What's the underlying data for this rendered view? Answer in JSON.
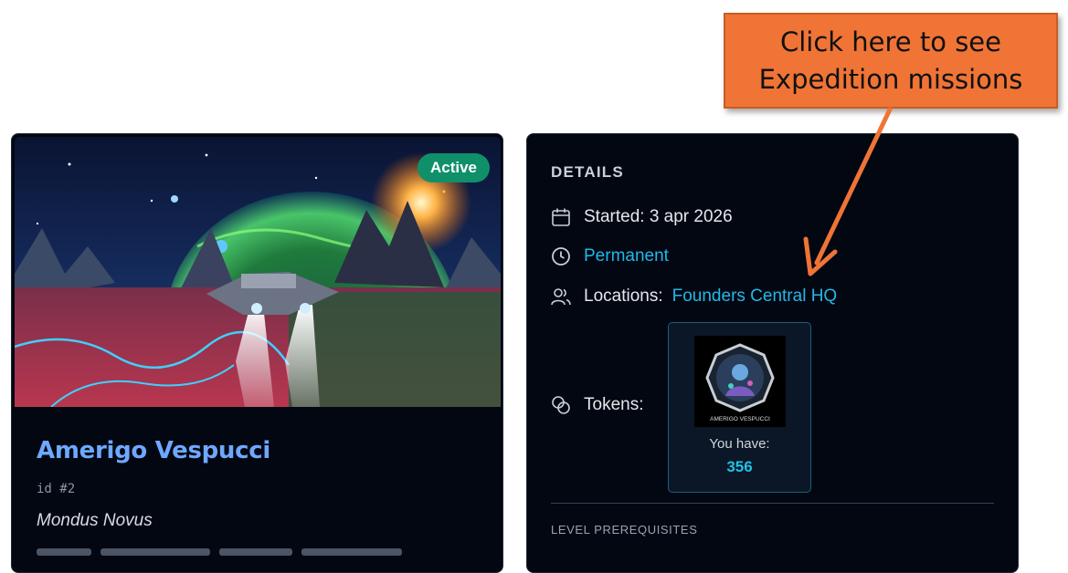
{
  "expedition": {
    "status": "Active",
    "name": "Amerigo Vespucci",
    "id_label": "id #2",
    "subtitle": "Mondus Novus",
    "image": "spaceship-planet-art"
  },
  "details": {
    "heading": "DETAILS",
    "started": "Started: 3 apr 2026",
    "duration": "Permanent",
    "locations_label": "Locations:",
    "location_link": "Founders Central HQ",
    "tokens_label": "Tokens:",
    "token_card": {
      "image_caption": "AMERIGO VESPUCCI",
      "you_have_label": "You have:",
      "count": "356"
    },
    "level_prerequisites_heading": "LEVEL PREREQUISITES"
  },
  "callout": {
    "line1": "Click here to see",
    "line2": "Expedition missions"
  },
  "icons": {
    "started": "calendar-icon",
    "duration": "clock-icon",
    "locations": "users-icon",
    "tokens": "coins-icon"
  },
  "colors": {
    "background": "#030712",
    "active_badge": "#10906a",
    "title": "#6ea8ff",
    "link": "#22b8e6",
    "callout": "#ef7436"
  }
}
